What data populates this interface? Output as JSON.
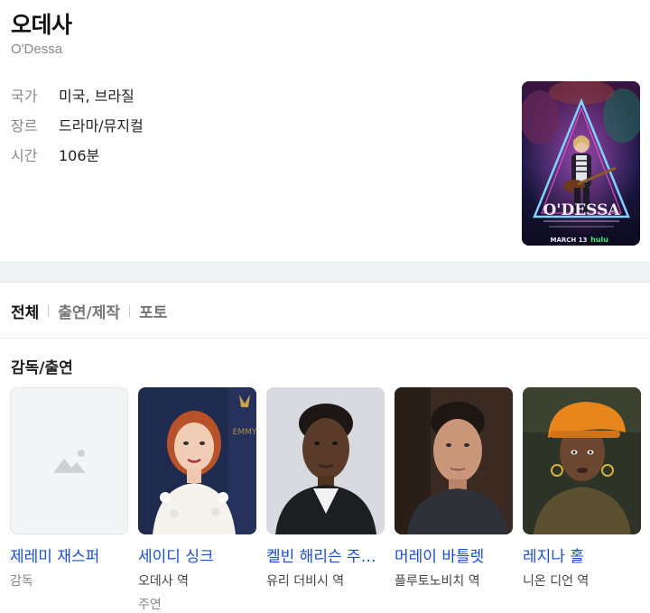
{
  "movie": {
    "title": "오데사",
    "original_title": "O'Dessa",
    "info": [
      {
        "key": "국가",
        "value": "미국, 브라질"
      },
      {
        "key": "장르",
        "value": "드라마/뮤지컬"
      },
      {
        "key": "시간",
        "value": "106분"
      }
    ],
    "poster": {
      "title_text": "O'DESSA",
      "date_text": "MARCH 13",
      "brand_text": "hulu"
    }
  },
  "tabs": [
    "전체",
    "출연/제작",
    "포토"
  ],
  "section_title": "감독/출연",
  "cast": [
    {
      "name": "제레미 재스퍼",
      "role": "감독",
      "role_extra": ""
    },
    {
      "name": "세이디 싱크",
      "role": "오데사 역",
      "role_extra": "주연"
    },
    {
      "name": "켈빈 해리슨 주니어",
      "role": "유리 더비시 역",
      "role_extra": ""
    },
    {
      "name": "머레이 바틀렛",
      "role": "플루토노비치 역",
      "role_extra": ""
    },
    {
      "name": "레지나 홀",
      "role": "니온 디언 역",
      "role_extra": ""
    }
  ],
  "colors": {
    "link": "#1a4fcc",
    "muted": "#888888",
    "band": "#f2f3f5"
  }
}
